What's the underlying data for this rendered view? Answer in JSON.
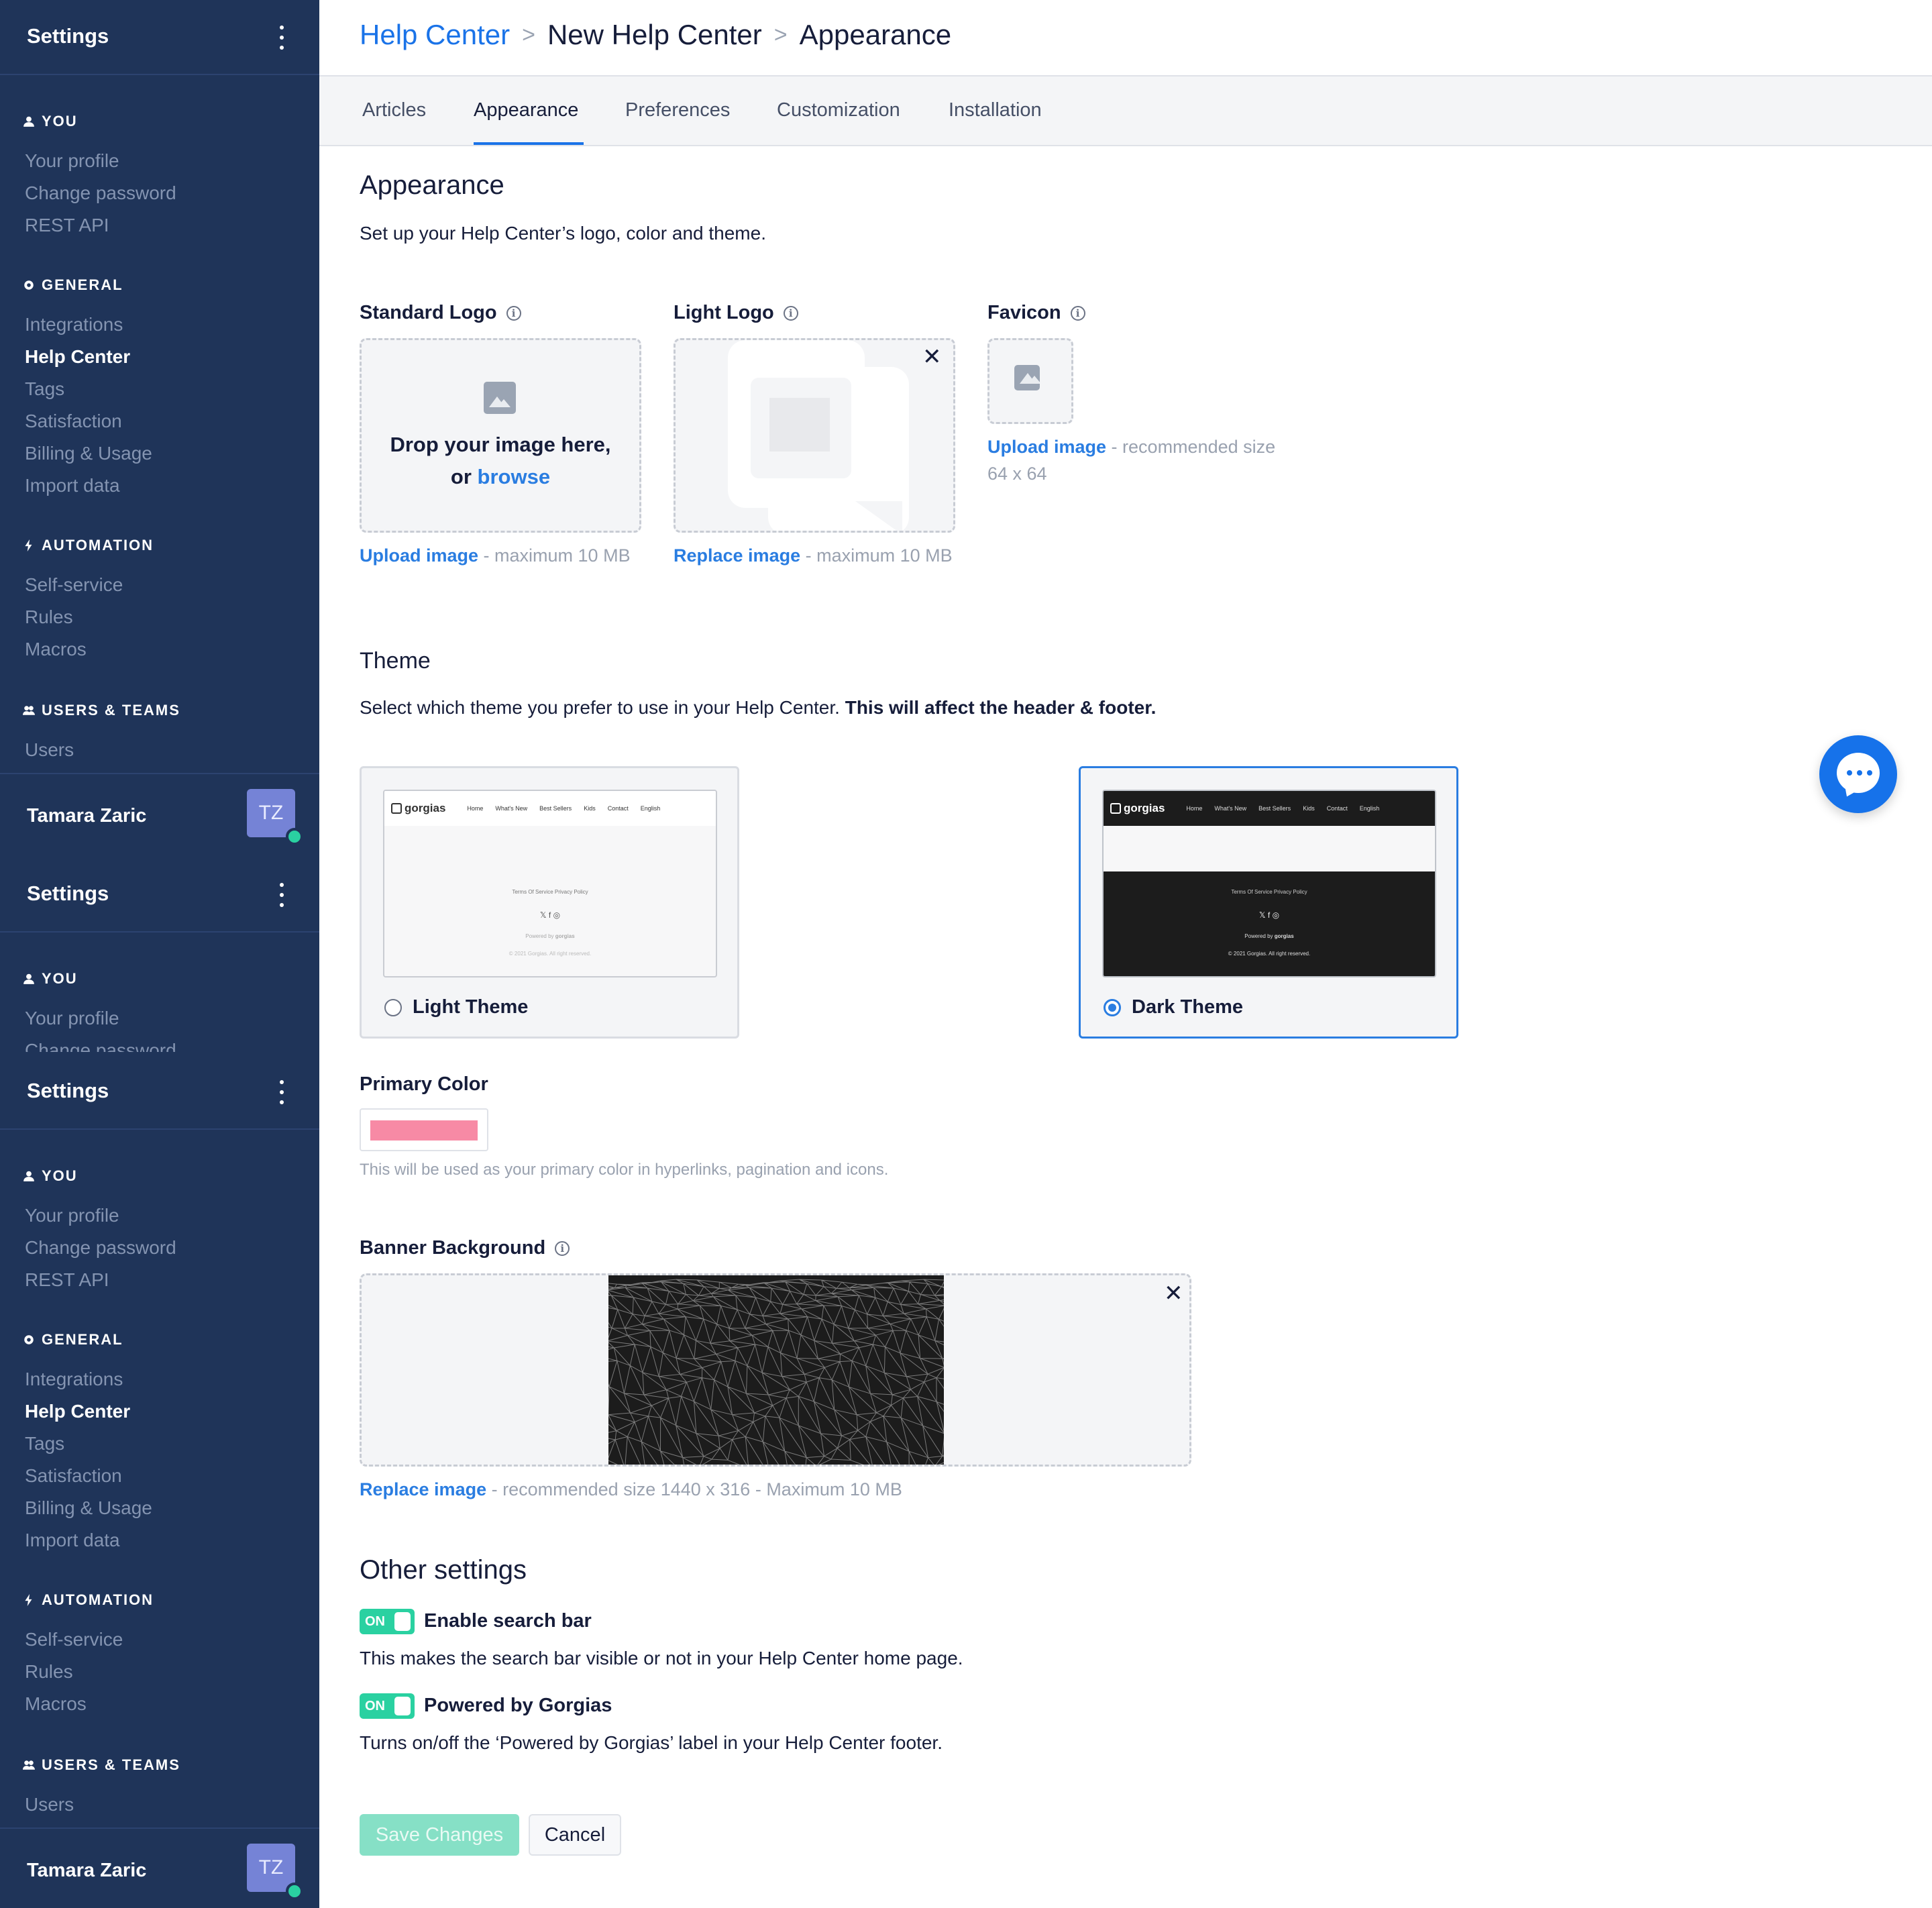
{
  "sidebar": {
    "title": "Settings",
    "sections": {
      "you": "YOU",
      "general": "GENERAL",
      "automation": "AUTOMATION",
      "users_teams": "USERS & TEAMS"
    },
    "items": {
      "your_profile": "Your profile",
      "change_password": "Change password",
      "rest_api": "REST API",
      "integrations": "Integrations",
      "help_center": "Help Center",
      "tags": "Tags",
      "satisfaction": "Satisfaction",
      "billing": "Billing & Usage",
      "import_data": "Import data",
      "self_service": "Self-service",
      "rules": "Rules",
      "macros": "Macros",
      "users": "Users"
    },
    "user": {
      "name": "Tamara Zaric",
      "initials": "TZ"
    }
  },
  "breadcrumb": {
    "root": "Help Center",
    "middle": "New Help Center",
    "current": "Appearance",
    "separator": ">"
  },
  "tabs": {
    "articles": "Articles",
    "appearance": "Appearance",
    "preferences": "Preferences",
    "customization": "Customization",
    "installation": "Installation",
    "active": "Appearance"
  },
  "appearance": {
    "title": "Appearance",
    "description": "Set up your Help Center’s logo, color and theme."
  },
  "logos": {
    "standard": {
      "label": "Standard Logo",
      "drop_text": "Drop your image here,",
      "or": "or",
      "browse": "browse",
      "link": "Upload image",
      "hint": "- maximum 10 MB"
    },
    "light": {
      "label": "Light Logo",
      "link": "Replace image",
      "hint": "- maximum 10 MB"
    },
    "favicon": {
      "label": "Favicon",
      "link": "Upload image",
      "hint": "- recommended size 64 x 64"
    }
  },
  "theme": {
    "title": "Theme",
    "description": "Select which theme you prefer to use in your Help Center.",
    "description_bold": "This will affect the header & footer.",
    "light_label": "Light Theme",
    "dark_label": "Dark Theme",
    "selected": "Dark Theme",
    "preview": {
      "brand": "gorgias",
      "nav": [
        "Home",
        "What's New",
        "Best Sellers",
        "Kids",
        "Contact"
      ],
      "lang": "English",
      "footer_links": "Terms Of Service     Privacy Policy",
      "social": "𝕏  f  ◎",
      "powered_prefix": "Powered by",
      "powered_brand": "gorgias",
      "copyright": "© 2021 Gorgias. All right reserved."
    }
  },
  "primary_color": {
    "label": "Primary Color",
    "value": "#f78aa5",
    "hint": "This will be used as your primary color in hyperlinks, pagination and icons."
  },
  "banner": {
    "label": "Banner Background",
    "link": "Replace image",
    "hint": "- recommended size 1440 x 316 - Maximum 10 MB"
  },
  "other_settings": {
    "title": "Other settings",
    "toggle_on": "ON",
    "search_bar": {
      "label": "Enable search bar",
      "enabled": true,
      "description": "This makes the search bar visible or not in your Help Center home page."
    },
    "powered": {
      "label": "Powered by Gorgias",
      "enabled": true,
      "description": "Turns on/off the ‘Powered by Gorgias’ label in your Help Center footer."
    }
  },
  "actions": {
    "save": "Save Changes",
    "cancel": "Cancel"
  },
  "colors": {
    "sidebar_bg": "#1f3459",
    "accent": "#1a73e8",
    "toggle_on": "#2ad1a1",
    "primary_swatch": "#f78aa5"
  }
}
